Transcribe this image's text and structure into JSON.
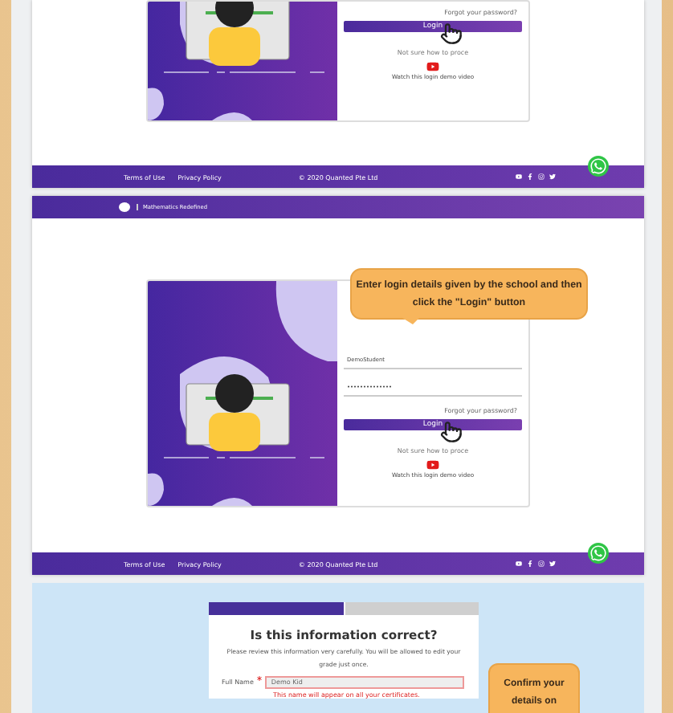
{
  "login_screens": [
    {
      "forgot": "Forgot your password?",
      "login_button": "Login",
      "help": "Not sure how to proce",
      "video_link": "Watch this login demo video",
      "footer": {
        "links": [
          "Terms of Use",
          "Privacy Policy"
        ],
        "copyright": "© 2020 Quanted Pte Ltd"
      }
    },
    {
      "header": "Mathematics Redefined",
      "callout": "Enter login details given by the school and then click the \"Login\" button",
      "username": "DemoStudent",
      "password": "••••••••••••••",
      "forgot": "Forgot your password?",
      "login_button": "Login",
      "help": "Not sure how to proce",
      "video_link": "Watch this login demo video",
      "footer": {
        "links": [
          "Terms of Use",
          "Privacy Policy"
        ],
        "copyright": "© 2020 Quanted Pte Ltd"
      }
    }
  ],
  "confirm_screen": {
    "steps": [
      {
        "selected": true
      },
      {
        "selected": false
      }
    ],
    "title": "Is this information correct?",
    "description": "Please review this information very carefully. You will be allowed to edit your grade just once.",
    "field": {
      "label": "Full Name",
      "required": true,
      "value": "Demo Kid",
      "error": "This name will appear on all your certificates."
    },
    "callout": "Confirm your details on"
  }
}
